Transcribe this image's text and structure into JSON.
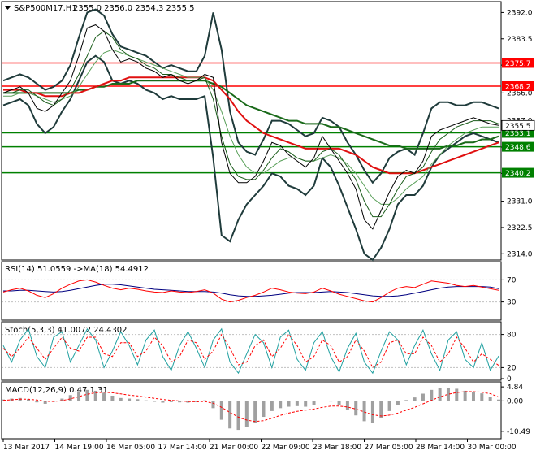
{
  "chart_data": {
    "type": "line",
    "title": "S&P500M17,H1",
    "ohlc": "2355.0 2356.0 2354.3 2355.5",
    "x_labels": [
      "13 Mar 2017",
      "14 Mar 19:00",
      "16 Mar 05:00",
      "17 Mar 14:00",
      "21 Mar 00:00",
      "22 Mar 09:00",
      "23 Mar 18:00",
      "27 Mar 05:00",
      "28 Mar 14:00",
      "30 Mar 00:00"
    ],
    "main": {
      "ylim": [
        2312.5,
        2395.0
      ],
      "y_ticks": [
        2392.0,
        2383.5,
        2375.0,
        2366.0,
        2357.0,
        2348.5,
        2340.0,
        2331.0,
        2322.5,
        2314.0
      ],
      "levels": [
        {
          "label": "2375.7",
          "value": 2375.7,
          "color": "#ff0000",
          "box": "#ff0000"
        },
        {
          "label": "2368.2",
          "value": 2368.2,
          "color": "#ff0000",
          "box": "#ff0000"
        },
        {
          "label": "2353.1",
          "value": 2353.1,
          "color": "#008000",
          "box": "#008000"
        },
        {
          "label": "2348.6",
          "value": 2348.6,
          "color": "#008000",
          "box": "#008000"
        },
        {
          "label": "2340.2",
          "value": 2340.2,
          "color": "#008000",
          "box": "#008000"
        }
      ],
      "current": {
        "label": "2355.5",
        "value": 2355.5
      },
      "price": [
        2366,
        2367,
        2368,
        2366,
        2361,
        2360,
        2362,
        2366,
        2370,
        2378,
        2387,
        2388,
        2386,
        2380,
        2376,
        2377,
        2376,
        2374,
        2373,
        2371,
        2372,
        2370,
        2369,
        2370,
        2372,
        2371,
        2350,
        2340,
        2337,
        2337,
        2339,
        2344,
        2350,
        2349,
        2346,
        2344,
        2342,
        2345,
        2352,
        2348,
        2344,
        2340,
        2335,
        2325,
        2322,
        2328,
        2334,
        2339,
        2341,
        2340,
        2344,
        2352,
        2354,
        2355,
        2356,
        2357,
        2358,
        2357,
        2356,
        2355.5
      ],
      "upper_band": [
        2370,
        2371,
        2372,
        2371,
        2369,
        2367,
        2368,
        2370,
        2375,
        2384,
        2392,
        2393,
        2391,
        2385,
        2381,
        2380,
        2379,
        2378,
        2376,
        2374,
        2375,
        2374,
        2373,
        2373,
        2378,
        2392,
        2380,
        2360,
        2350,
        2347,
        2346,
        2351,
        2357,
        2357,
        2356,
        2354,
        2352,
        2353,
        2358,
        2357,
        2355,
        2350,
        2346,
        2341,
        2337,
        2340,
        2345,
        2347,
        2348,
        2346,
        2353,
        2361,
        2363,
        2363,
        2362,
        2362,
        2363,
        2363,
        2362,
        2361
      ],
      "lower_band": [
        2362,
        2363,
        2364,
        2362,
        2356,
        2353,
        2355,
        2360,
        2364,
        2370,
        2376,
        2378,
        2376,
        2370,
        2369,
        2370,
        2369,
        2367,
        2366,
        2364,
        2365,
        2364,
        2364,
        2364,
        2365,
        2345,
        2320,
        2318,
        2325,
        2330,
        2333,
        2336,
        2340,
        2339,
        2336,
        2335,
        2333,
        2336,
        2345,
        2342,
        2336,
        2329,
        2322,
        2314,
        2312,
        2316,
        2322,
        2330,
        2333,
        2333,
        2336,
        2342,
        2346,
        2348,
        2350,
        2352,
        2353,
        2352,
        2351,
        2350
      ],
      "ma_fast": [
        2366,
        2366,
        2367,
        2367,
        2365,
        2363,
        2362,
        2364,
        2367,
        2372,
        2378,
        2384,
        2386,
        2384,
        2380,
        2378,
        2377,
        2375,
        2374,
        2372,
        2372,
        2371,
        2370,
        2370,
        2371,
        2364,
        2352,
        2343,
        2339,
        2338,
        2338,
        2341,
        2345,
        2348,
        2347,
        2345,
        2344,
        2344,
        2347,
        2348,
        2346,
        2342,
        2338,
        2331,
        2326,
        2326,
        2330,
        2335,
        2339,
        2340,
        2342,
        2347,
        2351,
        2353,
        2355,
        2356,
        2357,
        2357,
        2357,
        2356
      ],
      "ma_mid": [
        2365,
        2365,
        2366,
        2366,
        2365,
        2364,
        2363,
        2364,
        2365,
        2368,
        2372,
        2376,
        2379,
        2380,
        2379,
        2378,
        2377,
        2376,
        2375,
        2374,
        2373,
        2372,
        2371,
        2371,
        2371,
        2367,
        2360,
        2352,
        2346,
        2342,
        2340,
        2340,
        2342,
        2344,
        2345,
        2345,
        2344,
        2344,
        2345,
        2346,
        2345,
        2343,
        2340,
        2336,
        2332,
        2330,
        2330,
        2332,
        2335,
        2337,
        2339,
        2343,
        2346,
        2349,
        2351,
        2353,
        2354,
        2355,
        2355,
        2355
      ],
      "ma_slow_red": [
        2367,
        2367,
        2367,
        2366,
        2366,
        2365,
        2365,
        2365,
        2366,
        2366,
        2367,
        2368,
        2369,
        2370,
        2370,
        2371,
        2371,
        2371,
        2371,
        2371,
        2371,
        2371,
        2371,
        2371,
        2371,
        2370,
        2367,
        2364,
        2360,
        2357,
        2355,
        2353,
        2352,
        2351,
        2350,
        2349,
        2348,
        2348,
        2348,
        2348,
        2348,
        2347,
        2346,
        2344,
        2342,
        2341,
        2340,
        2340,
        2340,
        2340,
        2341,
        2342,
        2343,
        2344,
        2345,
        2346,
        2347,
        2348,
        2349,
        2350
      ],
      "ma_slow_green": [
        2366,
        2366,
        2366,
        2366,
        2366,
        2366,
        2366,
        2366,
        2366,
        2367,
        2367,
        2368,
        2368,
        2369,
        2369,
        2369,
        2370,
        2370,
        2370,
        2370,
        2370,
        2370,
        2370,
        2370,
        2370,
        2369,
        2368,
        2366,
        2364,
        2362,
        2361,
        2360,
        2359,
        2358,
        2357,
        2357,
        2356,
        2356,
        2356,
        2355,
        2355,
        2354,
        2353,
        2352,
        2351,
        2350,
        2349,
        2349,
        2348,
        2348,
        2348,
        2348,
        2348,
        2349,
        2349,
        2350,
        2350,
        2351,
        2351,
        2352
      ]
    },
    "rsi": {
      "label": "RSI(14) 51.0559  ->MA(18) 54.4912",
      "ylim": [
        0,
        100
      ],
      "y_ticks": [
        70,
        30
      ],
      "values": [
        48,
        52,
        55,
        50,
        42,
        38,
        45,
        55,
        62,
        68,
        70,
        66,
        60,
        55,
        52,
        55,
        53,
        50,
        48,
        47,
        50,
        48,
        47,
        49,
        52,
        46,
        35,
        30,
        33,
        38,
        42,
        48,
        55,
        52,
        48,
        46,
        45,
        48,
        55,
        50,
        44,
        40,
        36,
        32,
        30,
        38,
        48,
        55,
        58,
        56,
        62,
        68,
        66,
        64,
        60,
        58,
        60,
        57,
        54,
        51
      ],
      "ma": [
        50,
        50,
        51,
        51,
        50,
        49,
        48,
        49,
        51,
        54,
        57,
        60,
        62,
        62,
        61,
        59,
        57,
        55,
        53,
        52,
        51,
        50,
        49,
        49,
        49,
        48,
        46,
        43,
        41,
        40,
        40,
        41,
        42,
        44,
        46,
        47,
        47,
        47,
        48,
        49,
        48,
        47,
        45,
        43,
        41,
        40,
        40,
        41,
        43,
        46,
        49,
        52,
        55,
        57,
        58,
        58,
        58,
        58,
        57,
        54
      ]
    },
    "stoch": {
      "label": "Stoch(5,3,3) 41.0072 24.4302",
      "ylim": [
        0,
        100
      ],
      "y_ticks": [
        80,
        20,
        0
      ],
      "k": [
        60,
        30,
        70,
        90,
        40,
        20,
        75,
        85,
        30,
        60,
        90,
        70,
        20,
        50,
        85,
        60,
        25,
        70,
        88,
        40,
        15,
        60,
        85,
        55,
        20,
        70,
        90,
        30,
        10,
        45,
        80,
        65,
        20,
        75,
        88,
        35,
        15,
        65,
        85,
        40,
        12,
        55,
        82,
        30,
        10,
        50,
        85,
        70,
        25,
        60,
        88,
        45,
        15,
        70,
        85,
        35,
        20,
        65,
        15,
        41
      ],
      "d": [
        55,
        40,
        55,
        75,
        55,
        35,
        55,
        75,
        55,
        50,
        75,
        75,
        45,
        40,
        65,
        65,
        40,
        50,
        75,
        60,
        30,
        40,
        70,
        65,
        35,
        50,
        80,
        55,
        25,
        30,
        60,
        70,
        40,
        55,
        80,
        60,
        30,
        40,
        70,
        60,
        30,
        40,
        70,
        50,
        20,
        30,
        65,
        70,
        45,
        45,
        75,
        60,
        30,
        45,
        75,
        55,
        30,
        45,
        35,
        24
      ]
    },
    "macd": {
      "label": "MACD(12,26,9) 0.47 1.31",
      "ylim": [
        -12.5,
        6.0
      ],
      "y_ticks": [
        4.84,
        0.0,
        -10.49
      ],
      "hist": [
        0.5,
        0.8,
        1.0,
        0.6,
        -0.5,
        -1.0,
        -0.3,
        0.8,
        2.0,
        3.2,
        3.8,
        3.5,
        2.8,
        1.8,
        1.0,
        0.8,
        0.6,
        0.2,
        -0.3,
        -0.6,
        -0.4,
        -0.5,
        -0.6,
        -0.4,
        0.2,
        -2.5,
        -6.5,
        -9.5,
        -10.0,
        -9.0,
        -7.5,
        -5.5,
        -3.5,
        -2.5,
        -2.0,
        -1.8,
        -2.0,
        -1.5,
        0.0,
        -0.2,
        -1.5,
        -3.0,
        -5.0,
        -7.0,
        -7.5,
        -6.0,
        -3.5,
        -1.5,
        0.3,
        1.2,
        2.5,
        3.8,
        4.5,
        4.6,
        4.2,
        3.5,
        3.0,
        2.6,
        1.5,
        0.47
      ],
      "signal": [
        0.2,
        0.4,
        0.6,
        0.6,
        0.3,
        -0.1,
        -0.2,
        0.1,
        0.7,
        1.5,
        2.3,
        2.8,
        3.0,
        2.8,
        2.4,
        2.0,
        1.7,
        1.3,
        0.9,
        0.5,
        0.2,
        0.0,
        -0.2,
        -0.3,
        -0.2,
        -0.8,
        -2.2,
        -4.0,
        -5.6,
        -6.6,
        -7.1,
        -6.8,
        -6.0,
        -5.0,
        -4.2,
        -3.6,
        -3.2,
        -2.8,
        -2.2,
        -1.8,
        -1.8,
        -2.1,
        -2.8,
        -3.8,
        -4.8,
        -5.2,
        -4.9,
        -4.2,
        -3.2,
        -2.2,
        -1.0,
        0.2,
        1.4,
        2.3,
        2.9,
        3.2,
        3.2,
        3.0,
        2.5,
        1.31
      ]
    },
    "colors": {
      "price": "#000000",
      "band": "#1f3b3b",
      "ma_fast": "#1a5c1a",
      "ma_mid": "#5aa05a",
      "ma_slow_red": "#e01010",
      "ma_slow_green": "#1a6a1a",
      "rsi": "#ff0000",
      "rsi_ma": "#000080",
      "stoch_k": "#20a0a0",
      "stoch_d": "#ff0000",
      "macd_hist": "#a0a0a0",
      "macd_signal": "#ff0000"
    }
  }
}
